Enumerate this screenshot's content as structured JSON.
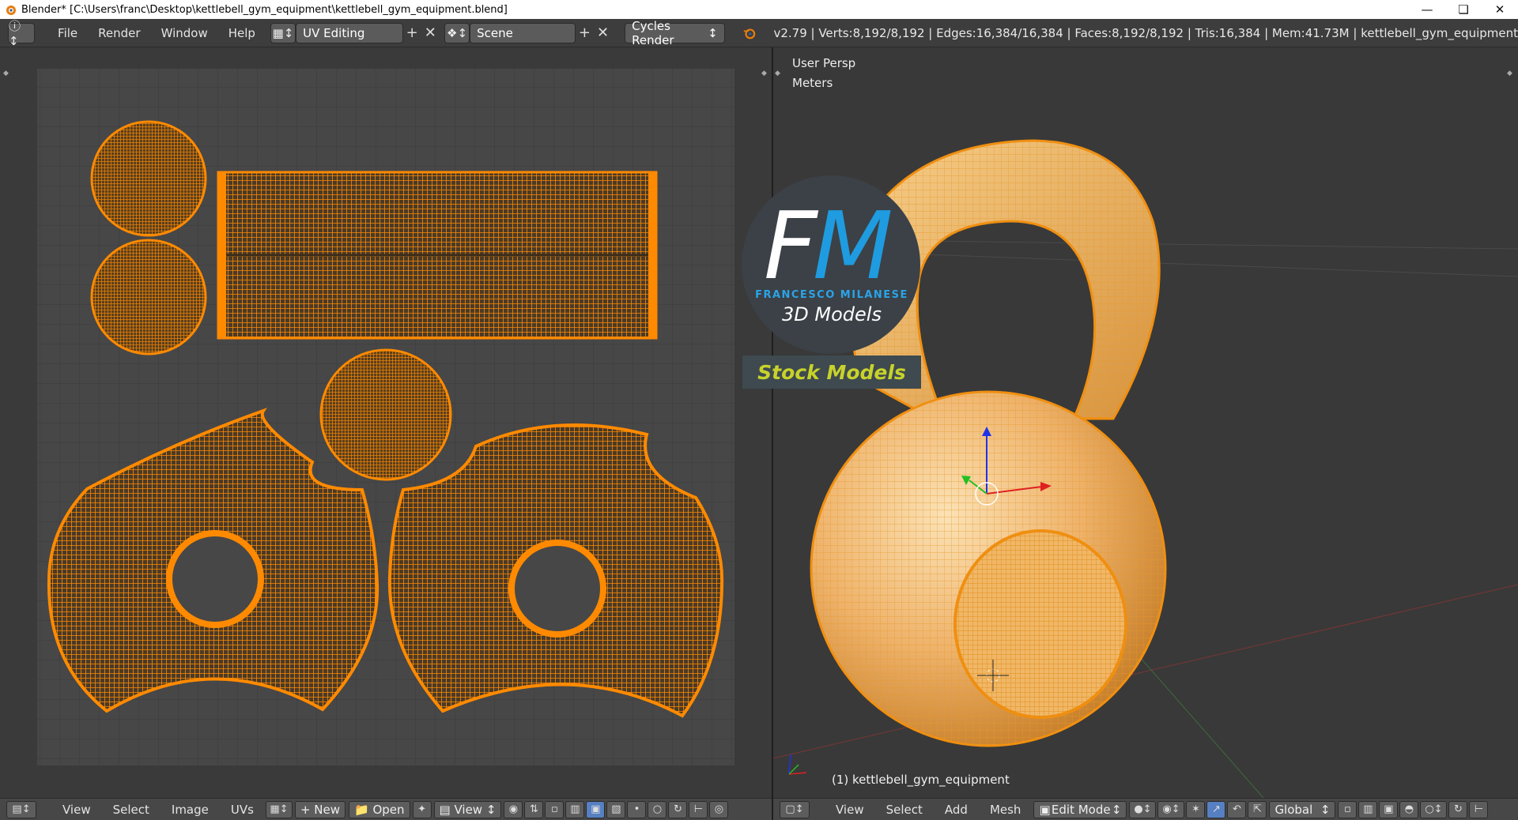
{
  "window": {
    "title": "Blender* [C:\\Users\\franc\\Desktop\\kettlebell_gym_equipment\\kettlebell_gym_equipment.blend]",
    "controls": [
      "minimize-icon",
      "restore-icon",
      "close-icon"
    ]
  },
  "info_header": {
    "menus": [
      "File",
      "Render",
      "Window",
      "Help"
    ],
    "screen_layout": "UV Editing",
    "scene": "Scene",
    "render_engine": "Cycles Render",
    "stats": "v2.79 | Verts:8,192/8,192 | Edges:16,384/16,384 | Faces:8,192/8,192 | Tris:16,384 | Mem:41.73M | kettlebell_gym_equipment"
  },
  "uv_editor": {
    "menus": [
      "View",
      "Select",
      "Image",
      "UVs"
    ],
    "new_label": "New",
    "open_label": "Open",
    "view_label": "View",
    "uv_color": "#ff8a00",
    "grid_color": "#444444"
  },
  "viewport": {
    "view_name": "User Persp",
    "units": "Meters",
    "object_label": "(1) kettlebell_gym_equipment",
    "menus": [
      "View",
      "Select",
      "Add",
      "Mesh"
    ],
    "mode": "Edit Mode",
    "orientation": "Global",
    "mesh_color": "#f3a630"
  },
  "logo": {
    "letter_f": "F",
    "letter_m": "M",
    "name": "FRANCESCO MILANESE",
    "subtitle": "3D Models",
    "banner": "Stock Models"
  }
}
